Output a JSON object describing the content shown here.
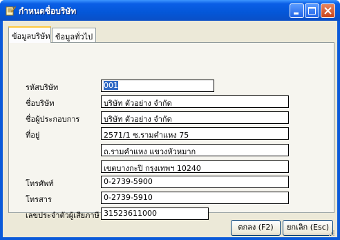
{
  "window": {
    "title": "กำหนดชื่อบริษัท"
  },
  "tabs": [
    {
      "label": "ข้อมูลบริษัท",
      "active": true
    },
    {
      "label": "ข้อมูลทั่วไป",
      "active": false
    }
  ],
  "form": {
    "company_code": {
      "label": "รหัสบริษัท",
      "value": "001"
    },
    "company_name": {
      "label": "ชื่อบริษัท",
      "value": "บริษัท ตัวอย่าง จำกัด"
    },
    "operator_name": {
      "label": "ชื่อผู้ประกอบการ",
      "value": "บริษัท ตัวอย่าง จำกัด"
    },
    "address": {
      "label": "ที่อยู่",
      "lines": [
        "2571/1 ซ.รามคำแหง 75",
        "ถ.รามคำแหง แขวงหัวหมาก",
        "เขตบางกะปิ กรุงเทพฯ 10240"
      ]
    },
    "phone": {
      "label": "โทรศัพท์",
      "value": "0-2739-5900"
    },
    "fax": {
      "label": "โทรสาร",
      "value": "0-2739-5910"
    },
    "tax_id": {
      "label": "เลขประจำตัวผู้เสียภาษี",
      "value": "31523611000"
    }
  },
  "buttons": {
    "ok": "ตกลง (F2)",
    "cancel": "ยกเลิก (Esc)"
  }
}
